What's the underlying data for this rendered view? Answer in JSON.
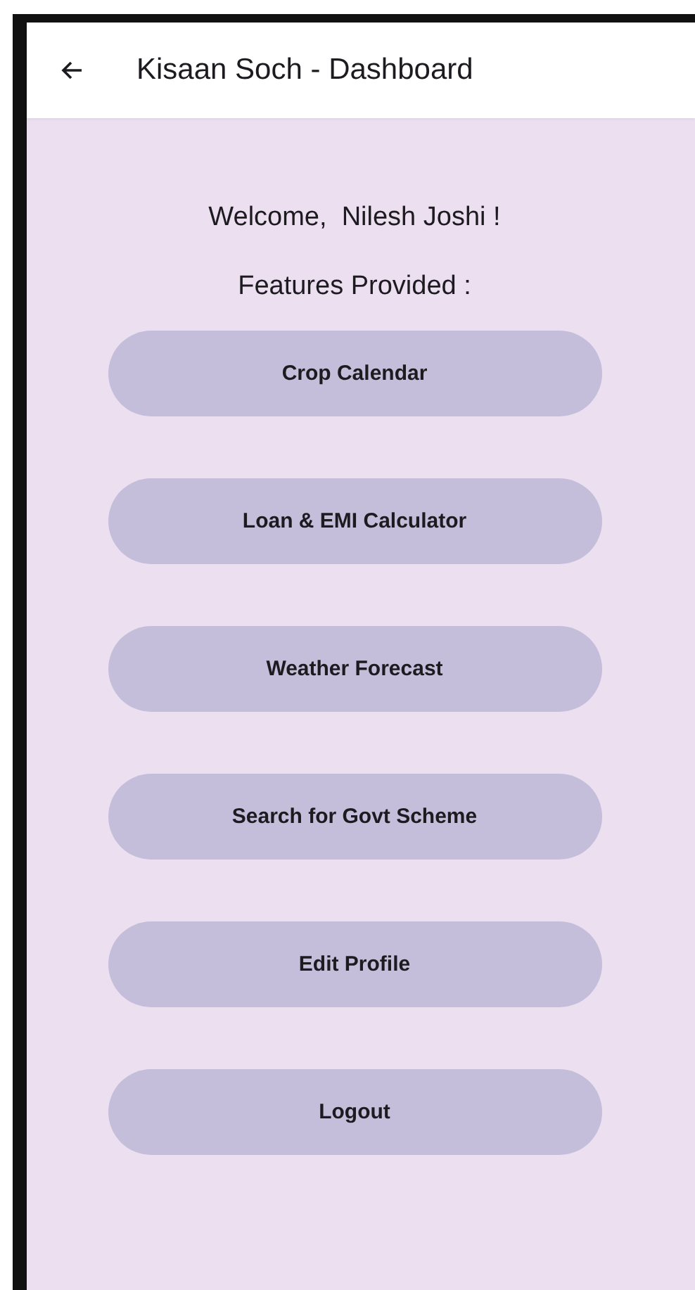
{
  "app_bar": {
    "title": "Kisaan Soch - Dashboard"
  },
  "welcome": "Welcome,  Nilesh Joshi !",
  "features_heading": "Features Provided :",
  "buttons": [
    "Crop Calendar",
    "Loan & EMI Calculator",
    "Weather Forecast",
    "Search for Govt Scheme",
    "Edit Profile",
    "Logout"
  ]
}
